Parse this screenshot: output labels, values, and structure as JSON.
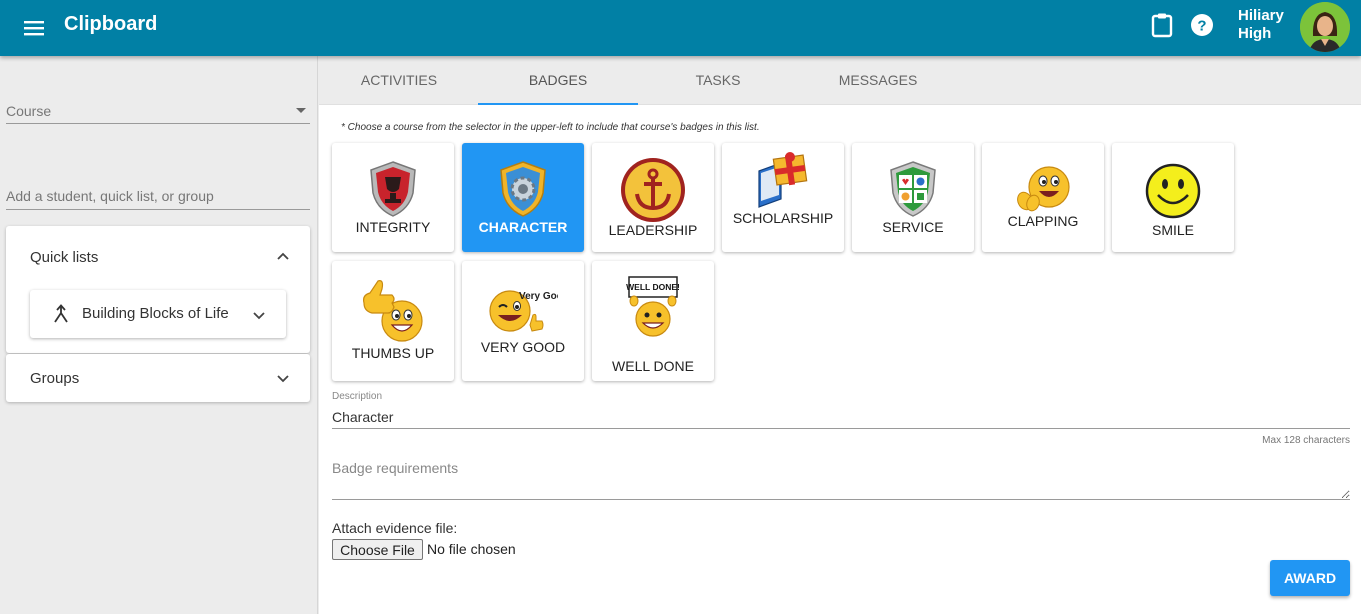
{
  "app": {
    "title": "Clipboard"
  },
  "header": {
    "menu_icon": "hamburger-menu-icon",
    "clipboard_icon": "clipboard-icon",
    "help_icon": "help-circle-icon",
    "user_name": "Hiliary High",
    "brand_color": "#0180a5"
  },
  "sidebar": {
    "course_label": "Course",
    "student_placeholder": "Add a student, quick list, or group",
    "quick_lists": {
      "title": "Quick lists",
      "items": [
        {
          "label": "Building Blocks of Life"
        }
      ]
    },
    "groups": {
      "title": "Groups"
    }
  },
  "tabs": [
    {
      "label": "ACTIVITIES",
      "active": false
    },
    {
      "label": "BADGES",
      "active": true
    },
    {
      "label": "TASKS",
      "active": false
    },
    {
      "label": "MESSAGES",
      "active": false
    }
  ],
  "badges_note": "* Choose a course from the selector in the upper-left to include that course's badges in this list.",
  "badges": [
    {
      "label": "INTEGRITY",
      "icon": "trophy-shield-icon",
      "selected": false
    },
    {
      "label": "CHARACTER",
      "icon": "gear-shield-icon",
      "selected": true
    },
    {
      "label": "LEADERSHIP",
      "icon": "anchor-icon",
      "selected": false
    },
    {
      "label": "SCHOLARSHIP",
      "icon": "book-gift-icon",
      "selected": false
    },
    {
      "label": "SERVICE",
      "icon": "helping-hands-shield-icon",
      "selected": false
    },
    {
      "label": "CLAPPING",
      "icon": "clapping-emoji-icon",
      "selected": false
    },
    {
      "label": "SMILE",
      "icon": "smiley-face-icon",
      "selected": false
    },
    {
      "label": "THUMBS UP",
      "icon": "thumbs-up-emoji-icon",
      "selected": false
    },
    {
      "label": "VERY GOOD",
      "icon": "very-good-emoji-icon",
      "icon_text": "Very Good",
      "selected": false
    },
    {
      "label": "WELL DONE",
      "icon": "well-done-emoji-icon",
      "icon_text": "WELL DONE!",
      "selected": false
    }
  ],
  "form": {
    "description_label": "Description",
    "description_value": "Character",
    "max_chars": "Max 128 characters",
    "requirements_placeholder": "Badge requirements",
    "attach_label": "Attach evidence file:",
    "choose_file": "Choose File",
    "no_file": "No file chosen",
    "award": "AWARD",
    "accent_color": "#2196f3"
  }
}
